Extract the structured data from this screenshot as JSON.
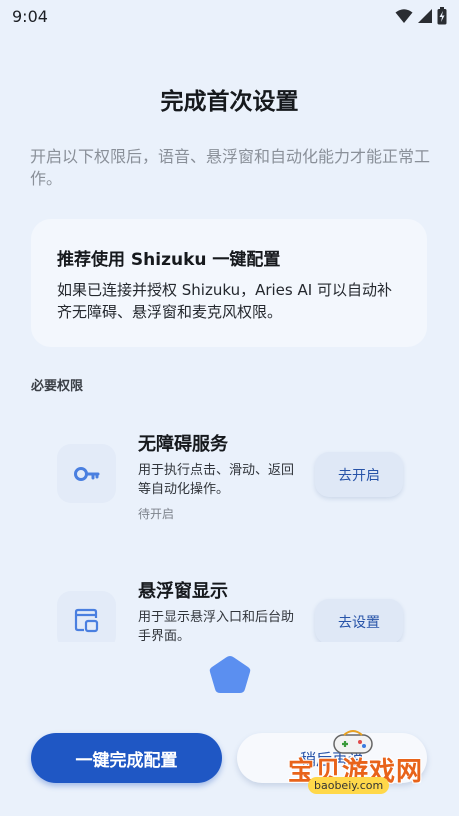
{
  "status_bar": {
    "time": "9:04"
  },
  "header": {
    "title": "完成首次设置",
    "subtitle": "开启以下权限后，语音、悬浮窗和自动化能力才能正常工作。"
  },
  "recommend": {
    "title": "推荐使用 Shizuku 一键配置",
    "description": "如果已连接并授权 Shizuku，Aries AI 可以自动补齐无障碍、悬浮窗和麦克风权限。"
  },
  "section": {
    "label": "必要权限"
  },
  "permissions": [
    {
      "icon": "key-icon",
      "title": "无障碍服务",
      "description": "用于执行点击、滑动、返回等自动化操作。",
      "status": "待开启",
      "button_label": "去开启"
    },
    {
      "icon": "floating-window-icon",
      "title": "悬浮窗显示",
      "description": "用于显示悬浮入口和后台助手界面。",
      "button_label": "去设置"
    }
  ],
  "footer": {
    "primary_label": "一键完成配置",
    "secondary_label": "稍后再说"
  },
  "watermark": {
    "text": "宝贝游戏网",
    "url": "baobeiy.com"
  },
  "colors": {
    "background": "#eaf1fb",
    "primary": "#1f57c4",
    "loader": "#5b8ff0",
    "icon": "#4a7fe0"
  }
}
